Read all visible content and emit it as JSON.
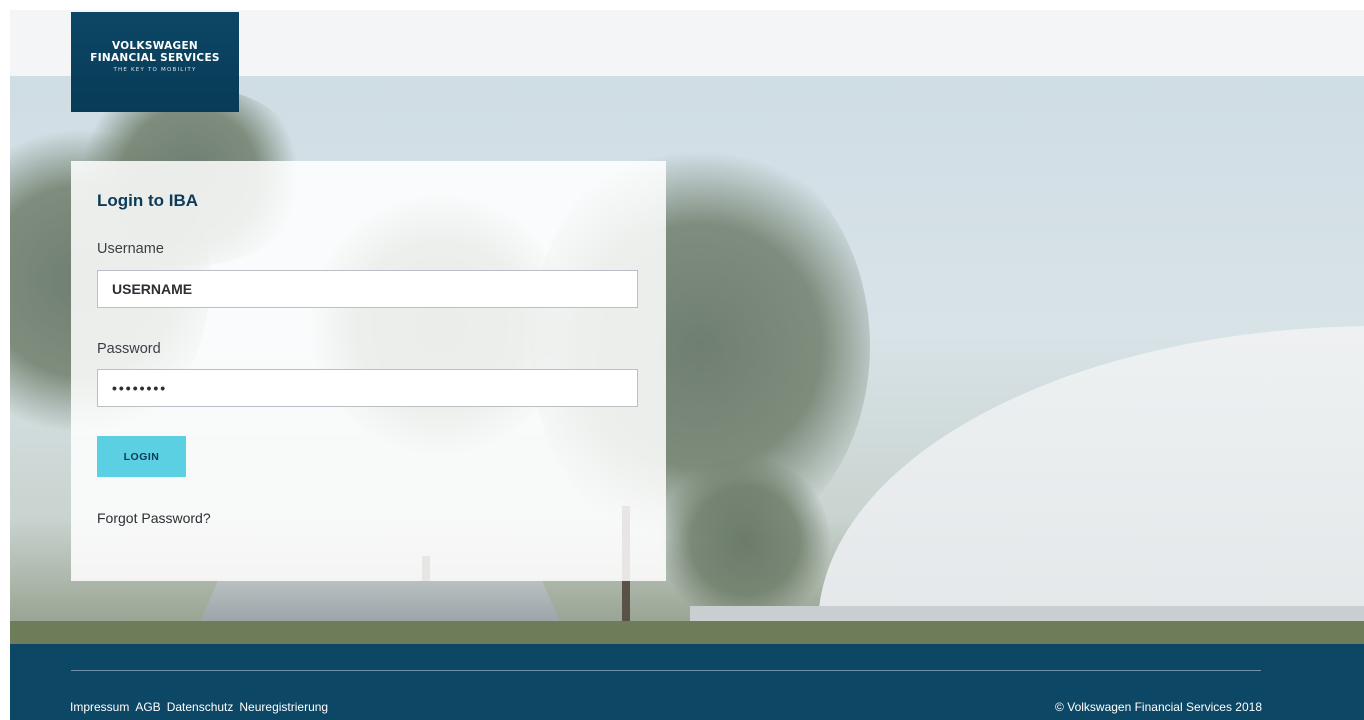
{
  "logo": {
    "line1": "VOLKSWAGEN",
    "line2": "FINANCIAL SERVICES",
    "tagline": "THE KEY TO MOBILITY"
  },
  "login": {
    "title": "Login to IBA",
    "username_label": "Username",
    "username_value": "USERNAME",
    "password_label": "Password",
    "password_value": "••••••••",
    "login_button": "LOGIN",
    "forgot_link": "Forgot Password?"
  },
  "footer": {
    "links": [
      "Impressum",
      "AGB",
      "Datenschutz",
      "Neuregistrierung"
    ],
    "copyright": "© Volkswagen Financial Services 2018"
  },
  "colors": {
    "brand_navy": "#0c4766",
    "accent_cyan": "#5bd0e2"
  }
}
